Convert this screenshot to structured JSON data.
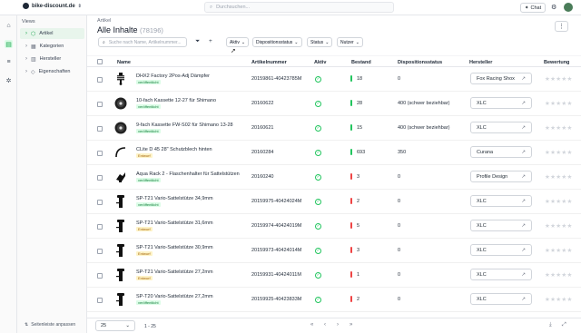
{
  "topbar": {
    "shop_name": "bike-discount.de",
    "search_placeholder": "Durchsuchen...",
    "chat_label": "Chat"
  },
  "sidebar": {
    "title": "Views",
    "items": [
      {
        "label": "Artikel",
        "icon": "box-icon",
        "active": true
      },
      {
        "label": "Kategorien",
        "icon": "grid-icon",
        "active": false
      },
      {
        "label": "Hersteller",
        "icon": "factory-icon",
        "active": false
      },
      {
        "label": "Eigenschaften",
        "icon": "tag-icon",
        "active": false
      }
    ],
    "footer_label": "Seitenleiste anpassen"
  },
  "main": {
    "breadcrumb": "Artikel",
    "title": "Alle Inhalte",
    "count": "(78196)",
    "search_placeholder": "Suche nach Name, Artikelnummer...",
    "filters": [
      "Aktiv",
      "Dispositionsstatus",
      "Status",
      "Nutzer"
    ]
  },
  "table": {
    "columns": [
      "Name",
      "Artikelnummer",
      "Aktiv",
      "Bestand",
      "Dispositionsstatus",
      "Hersteller",
      "Bewertung"
    ],
    "rows": [
      {
        "name": "DHX2 Factory 2Pos-Adj Dämpfer",
        "badge": "veröffentlicht",
        "badge_type": "green",
        "sku": "20159861-40423785M",
        "stock": "18",
        "stock_color": "#22c55e",
        "disposition": "0",
        "manufacturer": "Fox Racing Shox",
        "thumb": "shock"
      },
      {
        "name": "10-fach Kassette 12-27 für Shimano",
        "badge": "veröffentlicht",
        "badge_type": "green",
        "sku": "20160622",
        "stock": "28",
        "stock_color": "#22c55e",
        "disposition": "400 (schwer beziehbar)",
        "manufacturer": "XLC",
        "thumb": "cassette"
      },
      {
        "name": "9-fach Kassette FW-S02 für Shimano 13-28",
        "badge": "veröffentlicht",
        "badge_type": "green",
        "sku": "20160621",
        "stock": "15",
        "stock_color": "#22c55e",
        "disposition": "400 (schwer beziehbar)",
        "manufacturer": "XLC",
        "thumb": "cassette"
      },
      {
        "name": "CLite D 45 28\" Schutzblech hinten",
        "badge": "Entwurf",
        "badge_type": "yellow",
        "sku": "20160284",
        "stock": "693",
        "stock_color": "#22c55e",
        "disposition": "350",
        "manufacturer": "Curana",
        "thumb": "fender"
      },
      {
        "name": "Aqua Rack 2 - Flaschenhalter für Sattelstützen",
        "badge": "veröffentlicht",
        "badge_type": "green",
        "sku": "20160240",
        "stock": "3",
        "stock_color": "#ef4444",
        "disposition": "0",
        "manufacturer": "Profile Design",
        "thumb": "rack"
      },
      {
        "name": "SP-T21 Vario-Sattelstütze 34,9mm",
        "badge": "veröffentlicht",
        "badge_type": "green",
        "sku": "20159975-40424024M",
        "stock": "2",
        "stock_color": "#ef4444",
        "disposition": "0",
        "manufacturer": "XLC",
        "thumb": "post"
      },
      {
        "name": "SP-T21 Vario-Sattelstütze 31,6mm",
        "badge": "Entwurf",
        "badge_type": "yellow",
        "sku": "20159974-40424019M",
        "stock": "5",
        "stock_color": "#ef4444",
        "disposition": "0",
        "manufacturer": "XLC",
        "thumb": "post"
      },
      {
        "name": "SP-T21 Vario-Sattelstütze 30,9mm",
        "badge": "Entwurf",
        "badge_type": "yellow",
        "sku": "20159973-40424014M",
        "stock": "3",
        "stock_color": "#ef4444",
        "disposition": "0",
        "manufacturer": "XLC",
        "thumb": "post"
      },
      {
        "name": "SP-T21 Vario-Sattelstütze 27,2mm",
        "badge": "Entwurf",
        "badge_type": "yellow",
        "sku": "20159931-40424011M",
        "stock": "1",
        "stock_color": "#ef4444",
        "disposition": "0",
        "manufacturer": "XLC",
        "thumb": "post"
      },
      {
        "name": "SP-T20 Vario-Sattelstütze 27,2mm",
        "badge": "veröffentlicht",
        "badge_type": "green",
        "sku": "20159925-40423833M",
        "stock": "2",
        "stock_color": "#ef4444",
        "disposition": "0",
        "manufacturer": "XLC",
        "thumb": "post"
      }
    ]
  },
  "footer": {
    "page_size": "25",
    "range": "1 - 25"
  },
  "colors": {
    "accent": "#16a34a",
    "active_bg": "#dcfce7",
    "danger": "#ef4444"
  }
}
